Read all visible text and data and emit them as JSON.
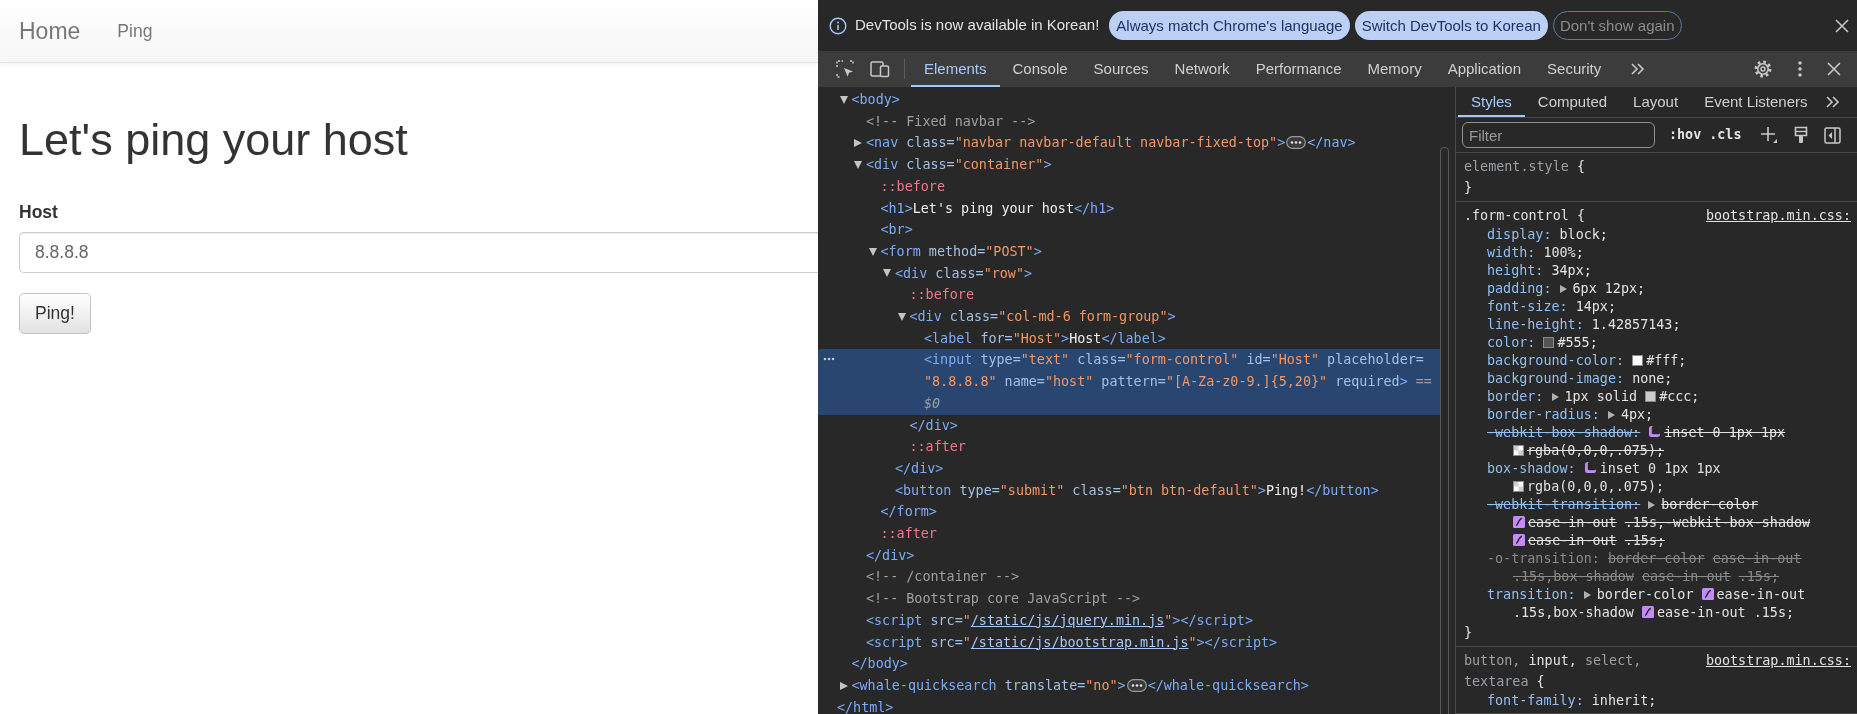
{
  "page": {
    "navbar": {
      "brand": "Home",
      "links": [
        {
          "label": "Ping"
        }
      ]
    },
    "heading": "Let's ping your host",
    "form": {
      "label": "Host",
      "field": {
        "placeholder": "8.8.8.8"
      },
      "button": "Ping!"
    }
  },
  "devtools": {
    "infobar": {
      "message": "DevTools is now available in Korean!",
      "buttons": [
        {
          "label": "Always match Chrome's language",
          "kind": "filled"
        },
        {
          "label": "Switch DevTools to Korean",
          "kind": "filled"
        },
        {
          "label": "Don't show again",
          "kind": "outline"
        }
      ]
    },
    "tabs": [
      {
        "label": "Elements",
        "selected": true
      },
      {
        "label": "Console",
        "selected": false
      },
      {
        "label": "Sources",
        "selected": false
      },
      {
        "label": "Network",
        "selected": false
      },
      {
        "label": "Performance",
        "selected": false
      },
      {
        "label": "Memory",
        "selected": false
      },
      {
        "label": "Application",
        "selected": false
      },
      {
        "label": "Security",
        "selected": false
      }
    ],
    "dom": {
      "children": [
        {
          "selected": false,
          "expanded": true,
          "line": [
            {
              "kind": "tag",
              "text": "<body>"
            }
          ],
          "closing": [
            {
              "kind": "tag",
              "text": "</body>"
            }
          ],
          "children": [
            {
              "selected": false,
              "line": [
                {
                  "kind": "comment",
                  "text": "<!-- Fixed navbar -->"
                }
              ]
            },
            {
              "selected": false,
              "expanded": false,
              "line": [
                {
                  "kind": "tag",
                  "text": "<nav"
                },
                {
                  "kind": "attr",
                  "text": " class="
                },
                {
                  "kind": "val",
                  "text": "\"navbar navbar-default navbar-fixed-top\""
                },
                {
                  "kind": "tag",
                  "text": ">"
                },
                {
                  "kind": "more"
                },
                {
                  "kind": "tag",
                  "text": "</nav>"
                }
              ]
            },
            {
              "selected": false,
              "expanded": true,
              "line": [
                {
                  "kind": "tag",
                  "text": "<div"
                },
                {
                  "kind": "attr",
                  "text": " class="
                },
                {
                  "kind": "val",
                  "text": "\"container\""
                },
                {
                  "kind": "tag",
                  "text": ">"
                }
              ],
              "closing": [
                {
                  "kind": "tag",
                  "text": "</div>"
                }
              ],
              "children": [
                {
                  "selected": false,
                  "line": [
                    {
                      "kind": "pseudo",
                      "text": "::before"
                    }
                  ]
                },
                {
                  "selected": false,
                  "line": [
                    {
                      "kind": "tag",
                      "text": "<h1>"
                    },
                    {
                      "kind": "text",
                      "text": "Let's ping your host"
                    },
                    {
                      "kind": "tag",
                      "text": "</h1>"
                    }
                  ]
                },
                {
                  "selected": false,
                  "line": [
                    {
                      "kind": "tag",
                      "text": "<br>"
                    }
                  ]
                },
                {
                  "selected": false,
                  "expanded": true,
                  "line": [
                    {
                      "kind": "tag",
                      "text": "<form"
                    },
                    {
                      "kind": "attr",
                      "text": " method="
                    },
                    {
                      "kind": "val",
                      "text": "\"POST\""
                    },
                    {
                      "kind": "tag",
                      "text": ">"
                    }
                  ],
                  "closing": [
                    {
                      "kind": "tag",
                      "text": "</form>"
                    }
                  ],
                  "children": [
                    {
                      "selected": false,
                      "expanded": true,
                      "line": [
                        {
                          "kind": "tag",
                          "text": "<div"
                        },
                        {
                          "kind": "attr",
                          "text": " class="
                        },
                        {
                          "kind": "val",
                          "text": "\"row\""
                        },
                        {
                          "kind": "tag",
                          "text": ">"
                        }
                      ],
                      "closing": [
                        {
                          "kind": "tag",
                          "text": "</div>"
                        }
                      ],
                      "children": [
                        {
                          "selected": false,
                          "line": [
                            {
                              "kind": "pseudo",
                              "text": "::before"
                            }
                          ]
                        },
                        {
                          "selected": false,
                          "expanded": true,
                          "line": [
                            {
                              "kind": "tag",
                              "text": "<div"
                            },
                            {
                              "kind": "attr",
                              "text": " class="
                            },
                            {
                              "kind": "val",
                              "text": "\"col-md-6 form-group\""
                            },
                            {
                              "kind": "tag",
                              "text": ">"
                            }
                          ],
                          "closing": [
                            {
                              "kind": "tag",
                              "text": "</div>"
                            }
                          ],
                          "children": [
                            {
                              "selected": false,
                              "line": [
                                {
                                  "kind": "tag",
                                  "text": "<label"
                                },
                                {
                                  "kind": "attr",
                                  "text": " for="
                                },
                                {
                                  "kind": "val",
                                  "text": "\"Host\""
                                },
                                {
                                  "kind": "tag",
                                  "text": ">"
                                },
                                {
                                  "kind": "text",
                                  "text": "Host"
                                },
                                {
                                  "kind": "tag",
                                  "text": "</label>"
                                }
                              ]
                            },
                            {
                              "selected": true,
                              "line": [
                                {
                                  "kind": "tag",
                                  "text": "<input"
                                },
                                {
                                  "kind": "attr",
                                  "text": " type="
                                },
                                {
                                  "kind": "val",
                                  "text": "\"text\""
                                },
                                {
                                  "kind": "attr",
                                  "text": " class="
                                },
                                {
                                  "kind": "val",
                                  "text": "\"form-control\""
                                },
                                {
                                  "kind": "attr",
                                  "text": " id="
                                },
                                {
                                  "kind": "val",
                                  "text": "\"Host\""
                                },
                                {
                                  "kind": "attr",
                                  "text": " placeholder="
                                },
                                {
                                  "kind": "val",
                                  "text": "\"8.8.8.8\""
                                },
                                {
                                  "kind": "attr",
                                  "text": " name="
                                },
                                {
                                  "kind": "val",
                                  "text": "\"host\""
                                },
                                {
                                  "kind": "attr",
                                  "text": " pattern="
                                },
                                {
                                  "kind": "val",
                                  "text": "\"[A-Za-z0-9.]{5,20}\""
                                },
                                {
                                  "kind": "attr",
                                  "text": " required"
                                },
                                {
                                  "kind": "tag",
                                  "text": ">"
                                },
                                {
                                  "kind": "hint",
                                  "text": " == $0"
                                }
                              ]
                            }
                          ]
                        },
                        {
                          "selected": false,
                          "line": [
                            {
                              "kind": "pseudo",
                              "text": "::after"
                            }
                          ]
                        }
                      ]
                    },
                    {
                      "selected": false,
                      "line": [
                        {
                          "kind": "tag",
                          "text": "<button"
                        },
                        {
                          "kind": "attr",
                          "text": " type="
                        },
                        {
                          "kind": "val",
                          "text": "\"submit\""
                        },
                        {
                          "kind": "attr",
                          "text": " class="
                        },
                        {
                          "kind": "val",
                          "text": "\"btn btn-default\""
                        },
                        {
                          "kind": "tag",
                          "text": ">"
                        },
                        {
                          "kind": "text",
                          "text": "Ping!"
                        },
                        {
                          "kind": "tag",
                          "text": "</button>"
                        }
                      ]
                    }
                  ]
                },
                {
                  "selected": false,
                  "line": [
                    {
                      "kind": "pseudo",
                      "text": "::after"
                    }
                  ]
                }
              ]
            },
            {
              "selected": false,
              "line": [
                {
                  "kind": "comment",
                  "text": "<!-- /container -->"
                }
              ]
            },
            {
              "selected": false,
              "line": [
                {
                  "kind": "comment",
                  "text": "<!-- Bootstrap core JavaScript -->"
                }
              ]
            },
            {
              "selected": false,
              "line": [
                {
                  "kind": "tag",
                  "text": "<script"
                },
                {
                  "kind": "attr",
                  "text": " src="
                },
                {
                  "kind": "val",
                  "text": "\""
                },
                {
                  "kind": "link",
                  "text": "/static/js/jquery.min.js"
                },
                {
                  "kind": "val",
                  "text": "\""
                },
                {
                  "kind": "tag",
                  "text": "></script>"
                }
              ]
            },
            {
              "selected": false,
              "line": [
                {
                  "kind": "tag",
                  "text": "<script"
                },
                {
                  "kind": "attr",
                  "text": " src="
                },
                {
                  "kind": "val",
                  "text": "\""
                },
                {
                  "kind": "link",
                  "text": "/static/js/bootstrap.min.js"
                },
                {
                  "kind": "val",
                  "text": "\""
                },
                {
                  "kind": "tag",
                  "text": "></script>"
                }
              ]
            }
          ]
        },
        {
          "selected": false,
          "expanded": false,
          "line": [
            {
              "kind": "tag",
              "text": "<whale-quicksearch"
            },
            {
              "kind": "attr",
              "text": " translate="
            },
            {
              "kind": "val",
              "text": "\"no\""
            },
            {
              "kind": "tag",
              "text": ">"
            },
            {
              "kind": "more"
            },
            {
              "kind": "tag",
              "text": "</whale-quicksearch>"
            }
          ]
        }
      ],
      "closing": [
        {
          "kind": "tag",
          "text": "</html>"
        }
      ]
    },
    "styles": {
      "tabs": [
        {
          "label": "Styles",
          "selected": true
        },
        {
          "label": "Computed",
          "selected": false
        },
        {
          "label": "Layout",
          "selected": false
        },
        {
          "label": "Event Listeners",
          "selected": false
        }
      ],
      "filter": {
        "placeholder": "Filter"
      },
      "toggles": [
        ":hov",
        ".cls"
      ],
      "rules": [
        {
          "selector": [
            {
              "text": "element.style",
              "dim": true
            }
          ],
          "open": "{",
          "close": "}"
        },
        {
          "selector": [
            {
              "text": ".form-control",
              "dim": false
            }
          ],
          "open": "{",
          "close": "}",
          "source": "bootstrap.min.css:",
          "declarations": [
            {
              "name": "display:",
              "value": [
                "block;"
              ],
              "struck": false,
              "invalid": false
            },
            {
              "name": "width:",
              "value": [
                "100%;"
              ],
              "struck": false,
              "invalid": false
            },
            {
              "name": "height:",
              "value": [
                "34px;"
              ],
              "struck": false,
              "invalid": false
            },
            {
              "name": "padding:",
              "value": [
                {
                  "kind": "expand"
                },
                "6px 12px;"
              ],
              "struck": false,
              "invalid": false
            },
            {
              "name": "font-size:",
              "value": [
                "14px;"
              ],
              "struck": false,
              "invalid": false
            },
            {
              "name": "line-height:",
              "value": [
                "1.42857143;"
              ],
              "struck": false,
              "invalid": false
            },
            {
              "name": "color:",
              "value": [
                {
                  "kind": "swatch",
                  "color": "#555555"
                },
                "#555;"
              ],
              "struck": false,
              "invalid": false
            },
            {
              "name": "background-color:",
              "value": [
                {
                  "kind": "swatch",
                  "color": "#ffffff"
                },
                "#fff;"
              ],
              "struck": false,
              "invalid": false
            },
            {
              "name": "background-image:",
              "value": [
                "none;"
              ],
              "struck": false,
              "invalid": false
            },
            {
              "name": "border:",
              "value": [
                {
                  "kind": "expand"
                },
                "1px solid",
                {
                  "kind": "swatch",
                  "color": "#cccccc"
                },
                "#ccc;"
              ],
              "struck": false,
              "invalid": false
            },
            {
              "name": "border-radius:",
              "value": [
                {
                  "kind": "expand"
                },
                "4px;"
              ],
              "struck": false,
              "invalid": false
            },
            {
              "name": "-webkit-box-shadow:",
              "value": [
                {
                  "kind": "shadow"
                },
                "inset 0 1px 1px",
                {
                  "kind": "alpha-swatch"
                },
                "rgba(0,0,0,.075);"
              ],
              "struck": true,
              "invalid": false
            },
            {
              "name": "box-shadow:",
              "value": [
                {
                  "kind": "shadow"
                },
                "inset 0 1px 1px",
                {
                  "kind": "alpha-swatch"
                },
                "rgba(0,0,0,.075);"
              ],
              "struck": false,
              "invalid": false
            },
            {
              "name": "-webkit-transition:",
              "value": [
                {
                  "kind": "expand"
                },
                "border-color",
                {
                  "kind": "easing"
                },
                "ease-in-out",
                ".15s,-webkit-box-shadow",
                {
                  "kind": "easing"
                },
                "ease-in-out",
                ".15s;"
              ],
              "struck": true,
              "invalid": false
            },
            {
              "name": "-o-transition:",
              "value": [
                "border-color",
                "ease-in-out",
                ".15s,box-shadow",
                "ease-in-out",
                ".15s;"
              ],
              "struck": true,
              "invalid": true
            },
            {
              "name": "transition:",
              "value": [
                {
                  "kind": "expand"
                },
                "border-color",
                {
                  "kind": "easing"
                },
                "ease-in-out",
                ".15s,box-shadow",
                {
                  "kind": "easing"
                },
                "ease-in-out",
                ".15s;"
              ],
              "struck": false,
              "invalid": false
            }
          ]
        },
        {
          "selector": [
            {
              "text": "button,",
              "dim": true
            },
            {
              "text": "input,",
              "dim": false
            },
            {
              "text": "select,",
              "dim": true
            },
            {
              "text": "textarea",
              "dim": true
            }
          ],
          "open": "{",
          "source": "bootstrap.min.css:",
          "declarations": [
            {
              "name": "font-family:",
              "value": [
                "inherit;"
              ],
              "struck": false,
              "invalid": false
            }
          ]
        }
      ]
    }
  }
}
